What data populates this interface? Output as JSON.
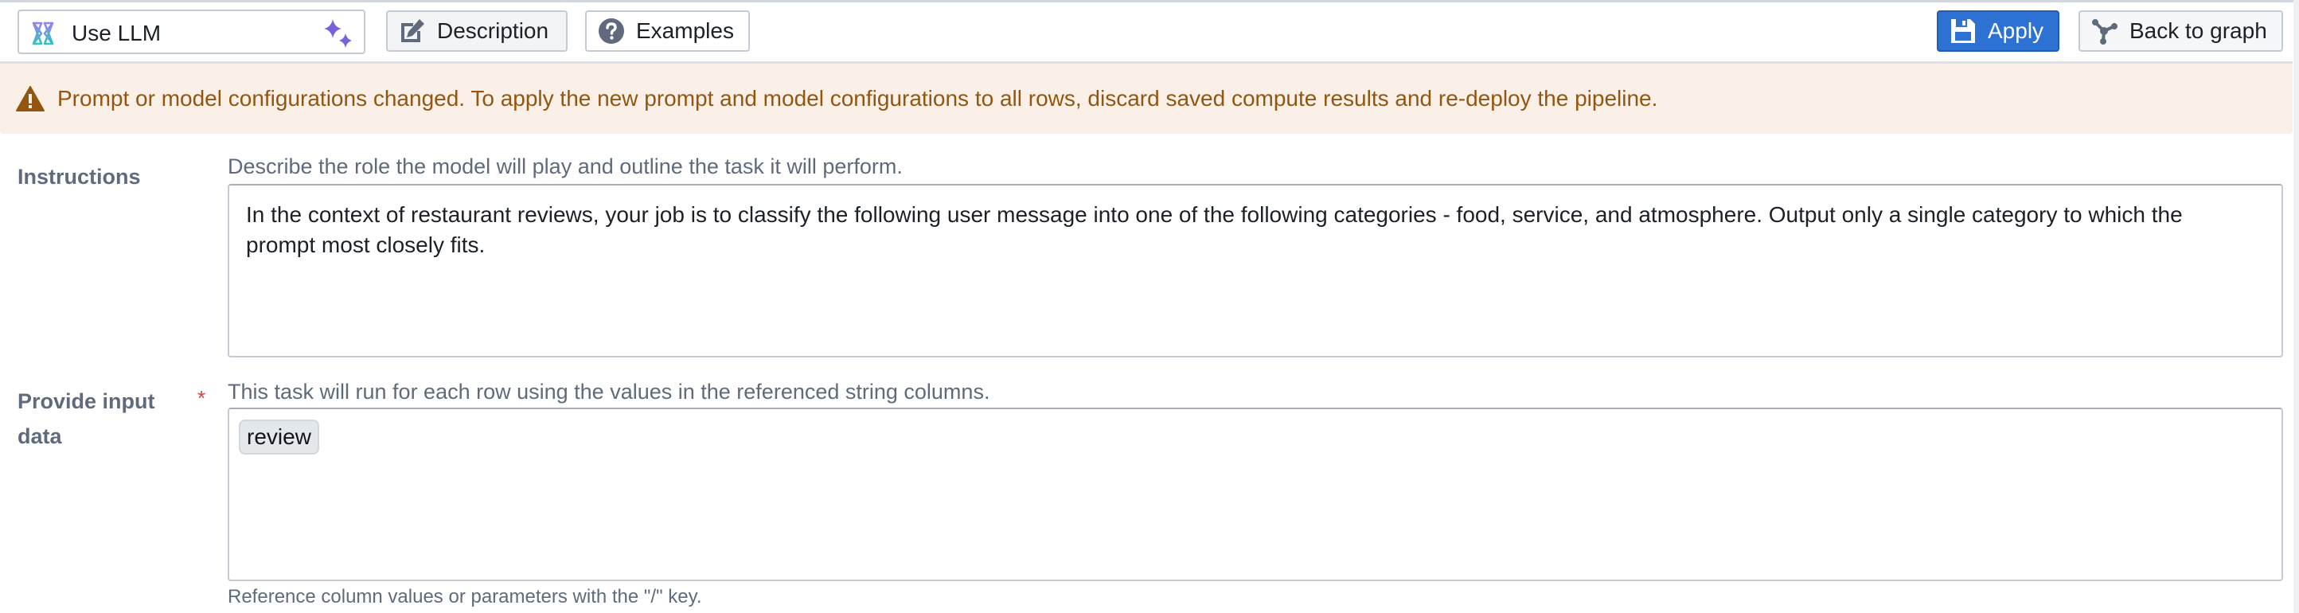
{
  "header": {
    "title_value": "Use LLM",
    "llm_icon": "llm-hourglass-icon",
    "sparkle_icon": "sparkle-icon",
    "buttons": {
      "description": {
        "label": "Description",
        "icon": "edit-icon"
      },
      "examples": {
        "label": "Examples",
        "icon": "help-icon"
      },
      "apply": {
        "label": "Apply",
        "icon": "floppy-disk-icon"
      },
      "back": {
        "label": "Back to graph",
        "icon": "graph-icon"
      }
    }
  },
  "warning": {
    "icon": "warning-triangle-icon",
    "text": "Prompt or model configurations changed. To apply the new prompt and model configurations to all rows, discard saved compute results and re-deploy the pipeline."
  },
  "instructions": {
    "label": "Instructions",
    "helper": "Describe the role the model will play and outline the task it will perform.",
    "value": "In the context of restaurant reviews, your job is to classify the following user message into one of the following categories - food, service, and atmosphere. Output only a single category to which the prompt most closely fits."
  },
  "input_data": {
    "label": "Provide input data",
    "required_marker": "*",
    "helper": "This task will run for each row using the values in the referenced string columns.",
    "chips": [
      "review"
    ],
    "footer_hint": "Reference column values or parameters with the \"/\" key."
  },
  "colors": {
    "primary": "#2d72d2",
    "warning_bg": "#faf0e8",
    "warning_text": "#935610",
    "label": "#5f6b7c",
    "required": "#cd4246",
    "sparkle": "#7961db"
  }
}
